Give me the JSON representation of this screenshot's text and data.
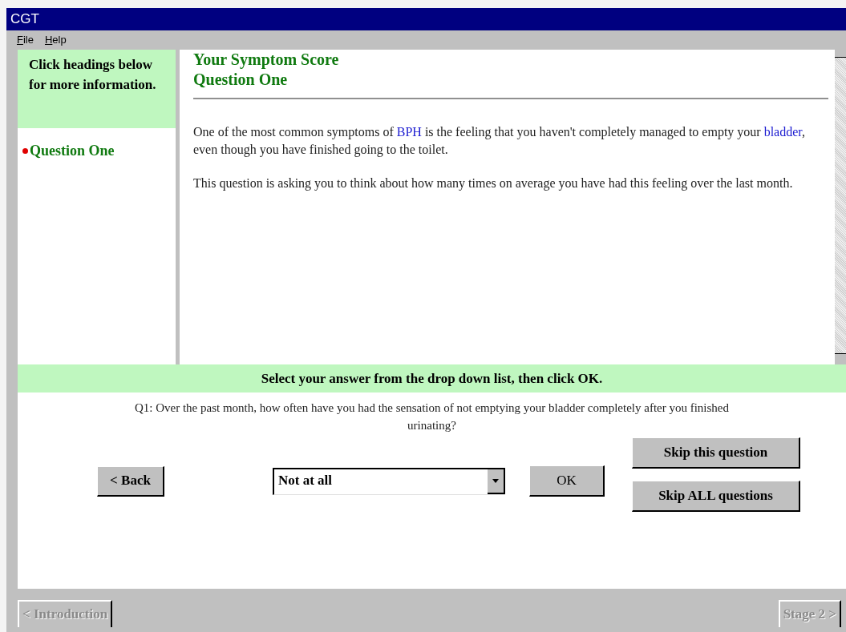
{
  "window": {
    "title": "CGT"
  },
  "menu": [
    {
      "label": "File"
    },
    {
      "label": "Help"
    }
  ],
  "sidebar": {
    "heading": "Click headings below for more information.",
    "items": [
      {
        "label": "Question One",
        "selected": true
      }
    ]
  },
  "content": {
    "title_lines": [
      "Your Symptom Score",
      "Question One"
    ],
    "paragraphs": [
      [
        {
          "kind": "text",
          "text": "One of the most common symptoms of "
        },
        {
          "kind": "link",
          "text": "BPH"
        },
        {
          "kind": "text",
          "text": " is the feeling that you haven't completely managed to empty your "
        },
        {
          "kind": "link",
          "text": "bladder"
        },
        {
          "kind": "text",
          "text": ", even though you have finished going to the toilet."
        }
      ],
      [
        {
          "kind": "text",
          "text": "This question is asking you to think about how many times on average you have had this feeling over the last month."
        }
      ]
    ]
  },
  "instruction": "Select your answer from the drop down list, then click OK.",
  "question": "Q1: Over the past month, how often have you had the sensation of not emptying your bladder completely after you finished urinating?",
  "controls": {
    "back": "< Back",
    "answer": "Not at all",
    "ok": "OK",
    "skip": "Skip this question",
    "skip_all": "Skip ALL questions"
  },
  "nav": [
    {
      "label": "< Introduction",
      "disabled": true
    },
    {
      "label": "Stage 2 >",
      "disabled": true
    }
  ]
}
